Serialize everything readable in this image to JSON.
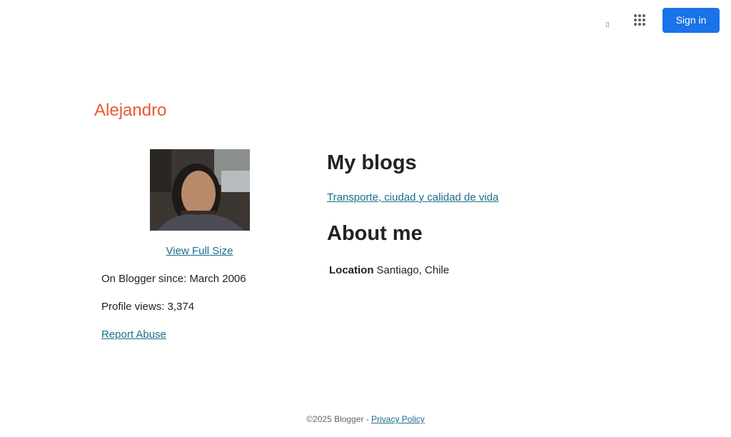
{
  "header": {
    "search_glyph": "▯",
    "apps_icon": "apps-grid-icon",
    "sign_in_label": "Sign in",
    "sign_in_color": "#1a73e8"
  },
  "profile": {
    "name": "Alejandro",
    "name_color": "#e8592f",
    "view_full_size": "View Full Size",
    "blogger_since": "On Blogger since: March 2006",
    "profile_views": "Profile views: 3,374",
    "report_abuse": "Report Abuse"
  },
  "blogs": {
    "heading": "My blogs",
    "items": [
      {
        "title": "Transporte, ciudad y calidad de vida"
      }
    ]
  },
  "about": {
    "heading": "About me",
    "location_label": "Location",
    "location_value": "Santiago, Chile"
  },
  "footer": {
    "copyright": "©2025 Blogger - ",
    "privacy_policy": "Privacy Policy"
  },
  "colors": {
    "link": "#1b6e8c",
    "text": "#222222"
  }
}
